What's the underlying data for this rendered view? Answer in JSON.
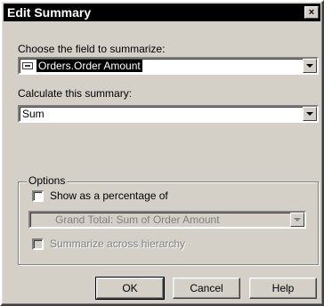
{
  "window": {
    "title": "Edit Summary",
    "close_glyph": "×"
  },
  "field_section": {
    "label": "Choose the field to summarize:",
    "selected_value": "Orders.Order Amount",
    "icon": "database-field-icon"
  },
  "summary_section": {
    "label": "Calculate this summary:",
    "selected_value": "Sum"
  },
  "options": {
    "legend": "Options",
    "show_percentage_label": "Show as a percentage of",
    "show_percentage_checked": false,
    "percentage_of_value": "Grand Total: Sum of Order Amount",
    "summarize_hierarchy_label": "Summarize across hierarchy",
    "summarize_hierarchy_checked": false
  },
  "buttons": {
    "ok": "OK",
    "cancel": "Cancel",
    "help": "Help"
  },
  "colors": {
    "face": "#d4d0c8",
    "titlebar": "#000000",
    "disabled_text": "#808080"
  }
}
